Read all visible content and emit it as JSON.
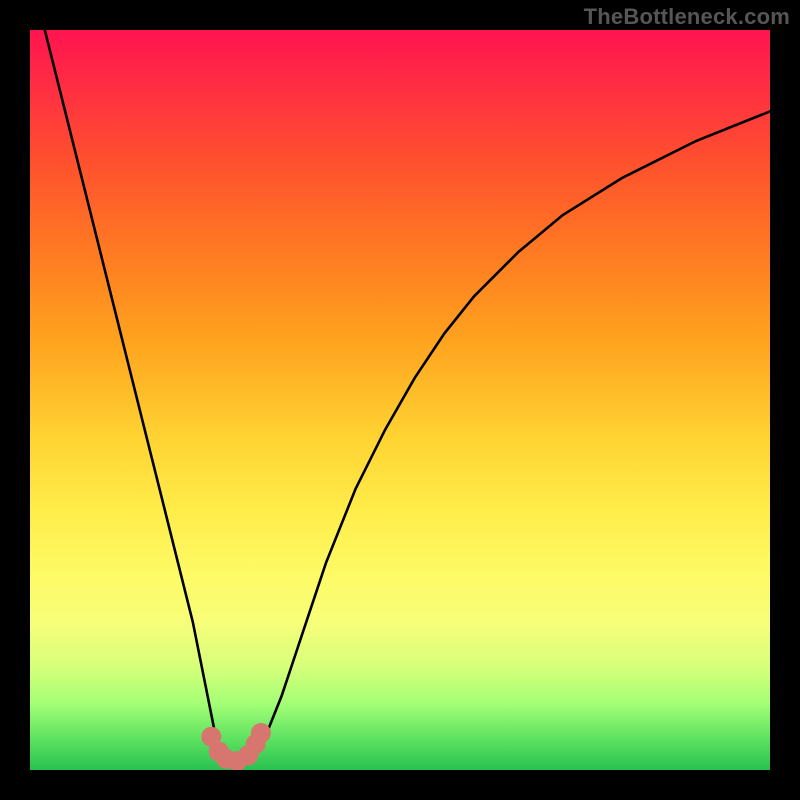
{
  "watermark": "TheBottleneck.com",
  "chart_data": {
    "type": "line",
    "title": "",
    "xlabel": "",
    "ylabel": "",
    "xlim": [
      0,
      100
    ],
    "ylim": [
      0,
      100
    ],
    "series": [
      {
        "name": "bottleneck-curve",
        "x": [
          2,
          4,
          6,
          8,
          10,
          12,
          14,
          16,
          18,
          20,
          22,
          24,
          25,
          26,
          27,
          28,
          29,
          30,
          31,
          32,
          34,
          36,
          38,
          40,
          44,
          48,
          52,
          56,
          60,
          66,
          72,
          80,
          90,
          100
        ],
        "values": [
          100,
          92,
          84,
          76,
          68,
          60,
          52,
          44,
          36,
          28,
          20,
          10,
          5,
          2,
          1,
          1,
          1,
          2,
          3,
          5,
          10,
          16,
          22,
          28,
          38,
          46,
          53,
          59,
          64,
          70,
          75,
          80,
          85,
          89
        ]
      }
    ],
    "markers": {
      "name": "near-minimum-points",
      "x": [
        24.5,
        25.5,
        26.5,
        28.0,
        29.5,
        30.5,
        31.2
      ],
      "y": [
        4.5,
        2.5,
        1.5,
        1.2,
        2.0,
        3.5,
        5.0
      ],
      "color": "#d6766e",
      "radius": 10
    },
    "gradient_stops": [
      {
        "pos": 0,
        "color": "#ff1450"
      },
      {
        "pos": 8,
        "color": "#ff2f42"
      },
      {
        "pos": 18,
        "color": "#ff512e"
      },
      {
        "pos": 30,
        "color": "#ff7a22"
      },
      {
        "pos": 42,
        "color": "#ffa31e"
      },
      {
        "pos": 55,
        "color": "#ffd332"
      },
      {
        "pos": 65,
        "color": "#ffed4a"
      },
      {
        "pos": 74,
        "color": "#fdfb67"
      },
      {
        "pos": 80,
        "color": "#f7fe79"
      },
      {
        "pos": 86,
        "color": "#d7ff7a"
      },
      {
        "pos": 91,
        "color": "#a4ff76"
      },
      {
        "pos": 96,
        "color": "#5be060"
      },
      {
        "pos": 100,
        "color": "#29c151"
      }
    ]
  }
}
